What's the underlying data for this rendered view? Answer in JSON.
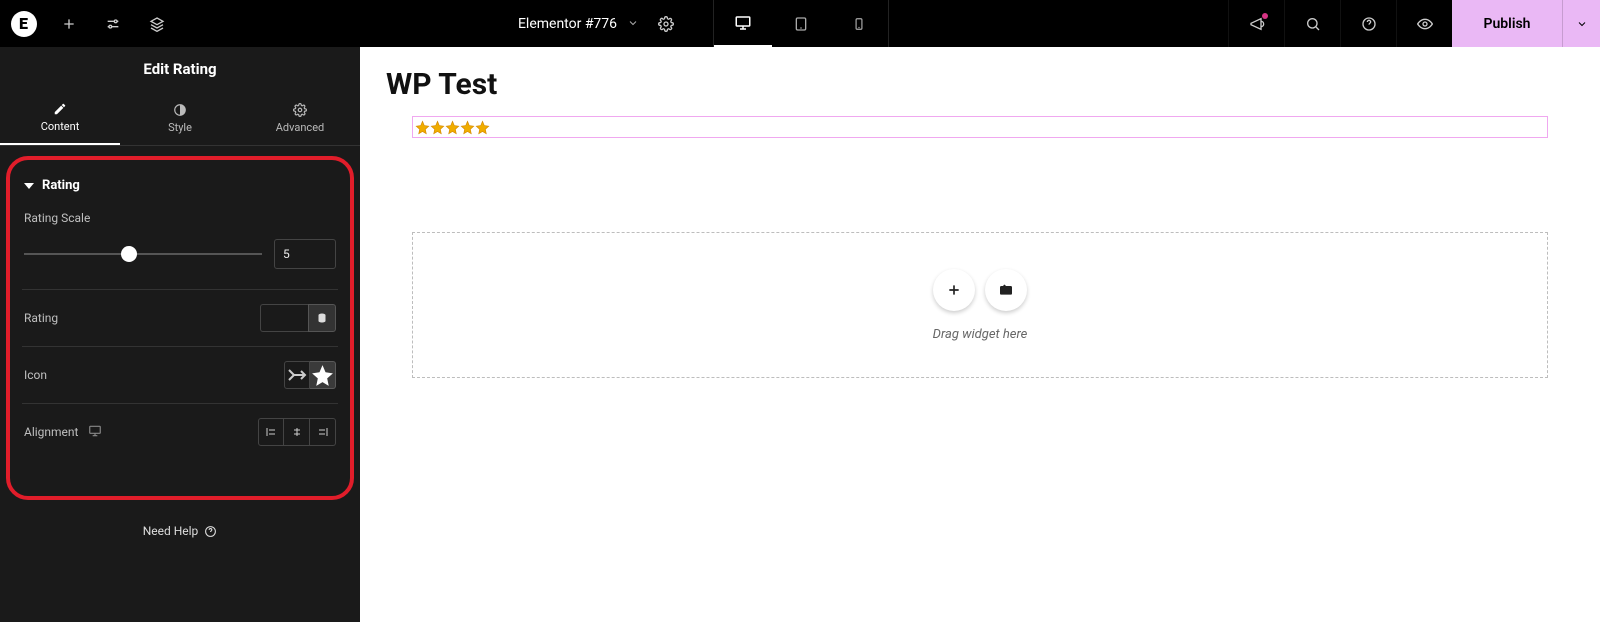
{
  "topbar": {
    "doc_title": "Elementor #776",
    "publish_label": "Publish"
  },
  "panel": {
    "title": "Edit Rating",
    "tabs": {
      "content": "Content",
      "style": "Style",
      "advanced": "Advanced"
    },
    "section_title": "Rating",
    "rating_scale_label": "Rating Scale",
    "rating_scale_value": "5",
    "rating_scale_min": 0,
    "rating_scale_max": 10,
    "rating_scale_percent": 44,
    "rating_label": "Rating",
    "rating_value": "",
    "icon_label": "Icon",
    "alignment_label": "Alignment",
    "need_help": "Need Help"
  },
  "canvas": {
    "page_heading": "WP Test",
    "star_count": 5,
    "dropzone_text": "Drag widget here"
  }
}
